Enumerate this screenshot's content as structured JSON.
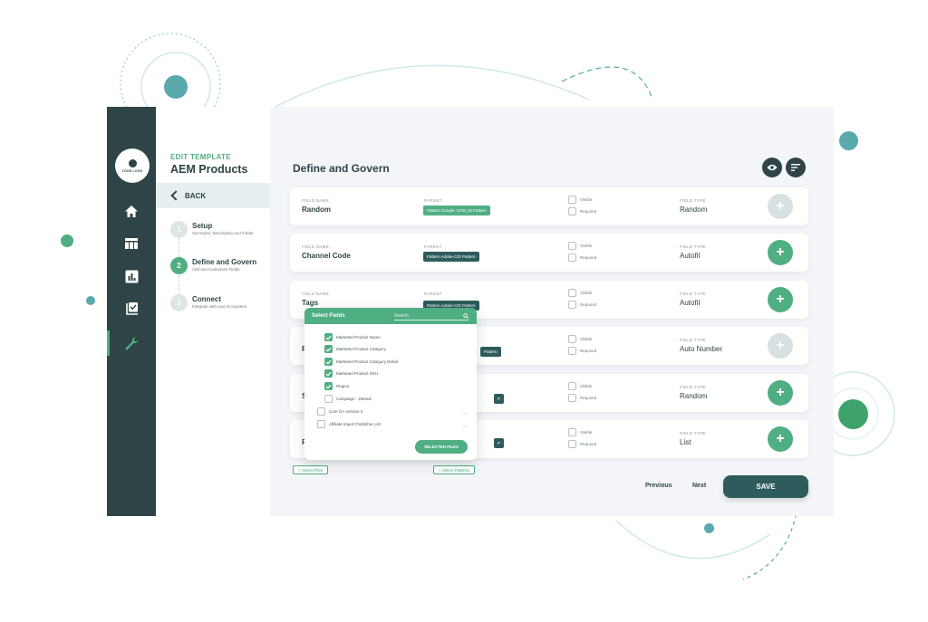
{
  "colors": {
    "dark": "#2e4446",
    "accent": "#4fae82",
    "teal": "#5aa9ad",
    "bg": "#f4f5f9",
    "disabled": "#d7e1e2"
  },
  "logo": {
    "text": "YOUR LOGO"
  },
  "nav": [
    {
      "icon": "home-icon"
    },
    {
      "icon": "table-icon"
    },
    {
      "icon": "chart-icon"
    },
    {
      "icon": "checklist-icon"
    },
    {
      "icon": "wrench-icon"
    }
  ],
  "steps_panel": {
    "edit_label": "EDIT TEMPLATE",
    "title": "AEM Products",
    "back": "BACK",
    "steps": [
      {
        "num": "1",
        "title": "Setup",
        "desc": "Set Name, Description and Folder"
      },
      {
        "num": "2",
        "title": "Define and Govern",
        "desc": "Add and Customize Fields"
      },
      {
        "num": "3",
        "title": "Connect",
        "desc": "Integrate with your Ecosystem"
      }
    ]
  },
  "main": {
    "title": "Define and Govern",
    "labels": {
      "field_name": "FIELD NAME",
      "parent": "PARENT",
      "field_type": "FIELD TYPE",
      "visible": "Visible",
      "required": "Required"
    },
    "rows": [
      {
        "field_name": "Random",
        "parent": "Pattern Google- UTM_ID Pattern",
        "field_type": "Random",
        "enabled": false
      },
      {
        "field_name": "Channel Code",
        "parent": "Pattern Adobe-CID Pattern",
        "field_type": "Autofil",
        "enabled": true
      },
      {
        "field_name": "Tags",
        "parent": "Pattern Adobe-CID Pattern",
        "field_type": "Autofil",
        "enabled": true
      },
      {
        "field_name": "R",
        "parent": "Pattern",
        "field_type": "Auto Number",
        "enabled": false
      },
      {
        "field_name": "S",
        "parent": "P",
        "field_type": "Random",
        "enabled": true
      },
      {
        "field_name": "P",
        "parent": "P",
        "field_type": "List",
        "enabled": true
      }
    ],
    "select_files": "+ Select Files",
    "select_patterns": "+ Select Patterns",
    "previous": "Previous",
    "next": "Next",
    "save": "SAVE"
  },
  "popup": {
    "title": "Select Fields",
    "search_placeholder": "Search",
    "items": [
      {
        "label": "Marketed Product Name",
        "checked": true
      },
      {
        "label": "Marketed Product Category",
        "checked": true
      },
      {
        "label": "Marketed Product Category Detail",
        "checked": true
      },
      {
        "label": "Marketed Product SKU",
        "checked": true
      },
      {
        "label": "Region",
        "checked": true
      },
      {
        "label": "Campaign - Default",
        "checked": false
      }
    ],
    "groups": [
      {
        "label": "Core GA Version 2"
      },
      {
        "label": "Affiliate Import Publisher List"
      }
    ],
    "button": "SELECTED FILES"
  }
}
